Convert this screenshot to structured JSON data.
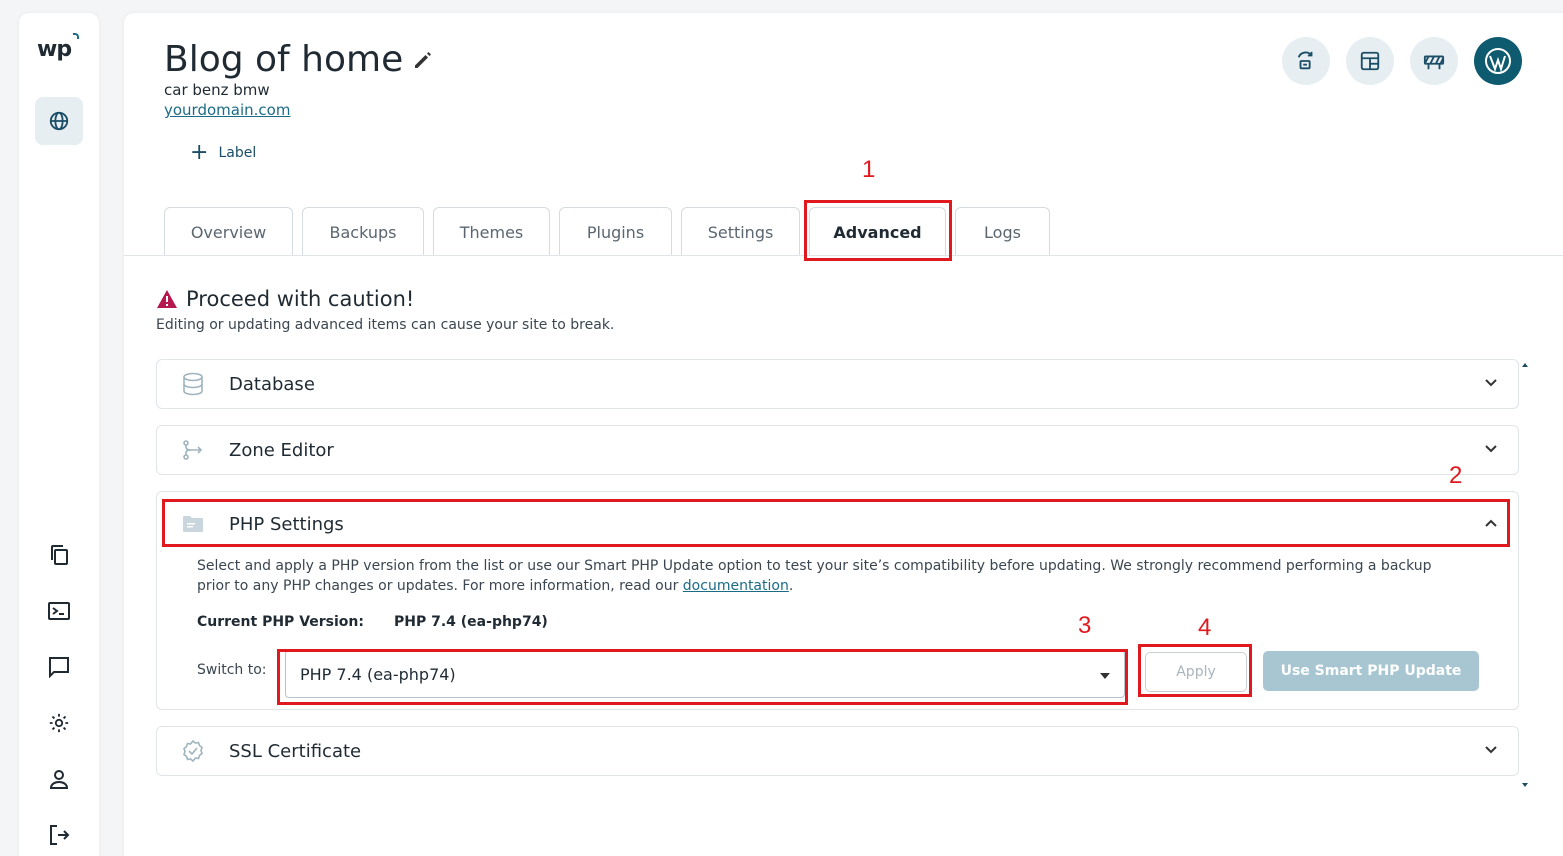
{
  "sidebar": {
    "logo": "wp",
    "icons": [
      "globe-icon",
      "copy-icon",
      "terminal-icon",
      "chat-icon",
      "gear-icon",
      "user-icon",
      "logout-icon"
    ]
  },
  "site": {
    "title": "Blog of home",
    "tagline": "car benz bmw",
    "domain": "yourdomain.com",
    "add_label": "Label"
  },
  "tabs": [
    {
      "label": "Overview",
      "active": false
    },
    {
      "label": "Backups",
      "active": false
    },
    {
      "label": "Themes",
      "active": false
    },
    {
      "label": "Plugins",
      "active": false
    },
    {
      "label": "Settings",
      "active": false
    },
    {
      "label": "Advanced",
      "active": true
    },
    {
      "label": "Logs",
      "active": false
    }
  ],
  "caution": {
    "title": "Proceed with caution!",
    "subtitle": "Editing or updating advanced items can cause your site to break."
  },
  "sections": {
    "database": "Database",
    "zone_editor": "Zone Editor",
    "php_settings": "PHP Settings",
    "ssl_certificate": "SSL Certificate"
  },
  "php": {
    "description_line1": "Select and apply a PHP version from the list or use our Smart PHP Update option to test your site’s compatibility before updating. We strongly recommend performing a backup",
    "description_line2": "prior to any PHP changes or updates. For more information, read our ",
    "doc_link": "documentation",
    "description_end": ".",
    "current_label": "Current PHP Version:",
    "current_value": "PHP 7.4 (ea-php74)",
    "switch_label": "Switch to:",
    "selected_option": "PHP 7.4 (ea-php74)",
    "apply_label": "Apply",
    "smart_label": "Use Smart PHP Update"
  },
  "annotations": [
    "1",
    "2",
    "3",
    "4"
  ],
  "colors": {
    "accent": "#1b6b87",
    "wp_button": "#0e5a6f",
    "annotation_red": "#e0191f",
    "warning": "#b5174e",
    "smart_button": "#a7c6d1"
  }
}
